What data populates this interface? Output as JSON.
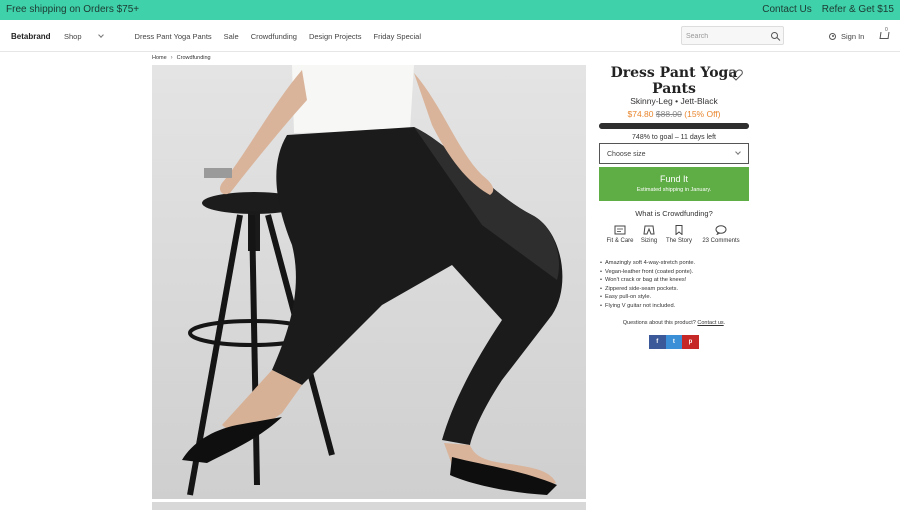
{
  "promo": {
    "left_text": "Free shipping on Orders $75+",
    "contact": "Contact Us",
    "refer": "Refer & Get $15"
  },
  "nav": {
    "logo": "Betabrand",
    "items": [
      "Shop",
      "Dress Pant Yoga Pants",
      "Sale",
      "Crowdfunding",
      "Design Projects",
      "Friday Special"
    ],
    "search_placeholder": "Search",
    "sign_in": "Sign In",
    "cart_count": "0"
  },
  "breadcrumb": {
    "home": "Home",
    "current": "Crowdfunding"
  },
  "product": {
    "title_line1": "Dress Pant Yoga",
    "title_line2": "Pants",
    "subtitle": "Skinny-Leg • Jett-Black",
    "price": "$74.80",
    "old_price": "$88.00",
    "discount": "(15% Off)",
    "progress": 1.0,
    "goal_text": "748% to goal – 11 days left",
    "size_select": "Choose size",
    "fund_label": "Fund It",
    "fund_sub": "Estimated shipping in January.",
    "what_is": "What is Crowdfunding?",
    "tabs": [
      "Fit & Care",
      "Sizing",
      "The Story",
      "23 Comments"
    ],
    "bullets": [
      "Amazingly soft 4-way-stretch ponte.",
      "Vegan-leather front (coated ponte).",
      "Won't crack or bag at the knees!",
      "Zippered side-seam pockets.",
      "Easy pull-on style.",
      "Flying V guitar not included."
    ],
    "questions": "Questions about this product?",
    "contact_link": "Contact us",
    "questions_end": ".",
    "social": [
      "f",
      "t",
      "p"
    ]
  },
  "colors": {
    "promo_bg": "#3fd1a9",
    "fund_bg": "#5fad45",
    "price": "#e8862e"
  }
}
